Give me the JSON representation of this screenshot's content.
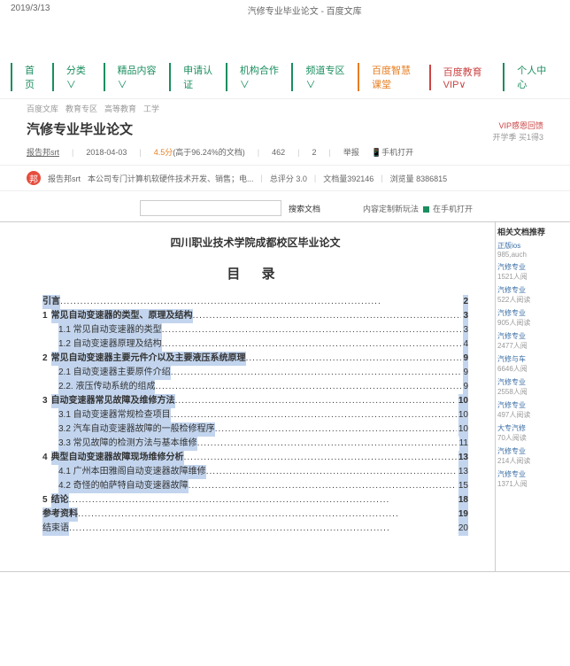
{
  "header": {
    "date": "2019/3/13",
    "pageTitle": "汽修专业毕业论文 - 百度文库"
  },
  "nav": [
    "首页",
    "分类 ∨",
    "精品内容 ∨",
    "申请认证",
    "机构合作 ∨",
    "频道专区 ∨",
    "百度智慧课堂",
    "百度教育VIP∨",
    "个人中心"
  ],
  "breadcrumb": [
    "百度文库",
    "教育专区",
    "高等教育",
    "工学"
  ],
  "title": "汽修专业毕业论文",
  "vip": {
    "line1": "VIP感恩回馈",
    "line2": "开学季 买1得3"
  },
  "meta": {
    "author": "报告邦srt",
    "date": "2018-04-03",
    "rating": "4.5分",
    "ratingSuffix": "(高于96.24%的文档)",
    "count1": "462",
    "count2": "2",
    "label": "举报",
    "extra": "手机打开"
  },
  "profile": {
    "avatarLetter": "邦",
    "name": "报告邦srt",
    "desc": "本公司专门计算机软硬件技术开发、销售；电...",
    "stats1": "总评分 3.0",
    "stats2": "文档量392146",
    "stats3": "浏览量 8386815"
  },
  "search": {
    "btn": "搜索文档",
    "opt1": "内容定制新玩法",
    "opt2": "在手机打开"
  },
  "doc": {
    "heading": "四川职业技术学院成都校区毕业论文",
    "tocTitle": "目 录"
  },
  "toc": [
    {
      "num": "",
      "txt": "引言",
      "pg": "2",
      "bold": true,
      "sub": false
    },
    {
      "num": "1",
      "txt": "常见自动变速器的类型、原理及结构",
      "pg": "3",
      "bold": true,
      "sub": false
    },
    {
      "num": "",
      "txt": "1.1 常见自动变速器的类型",
      "pg": "3",
      "bold": false,
      "sub": true
    },
    {
      "num": "",
      "txt": "1.2 自动变速器原理及结构",
      "pg": "4",
      "bold": false,
      "sub": true
    },
    {
      "num": "2",
      "txt": "常见自动变速器主要元件介以及主要液压系统原理",
      "pg": "9",
      "bold": true,
      "sub": false
    },
    {
      "num": "",
      "txt": "2.1 自动变速器主要原件介绍",
      "pg": "9",
      "bold": false,
      "sub": true
    },
    {
      "num": "",
      "txt": "2.2. 液压传动系统的组成",
      "pg": "9",
      "bold": false,
      "sub": true
    },
    {
      "num": "3",
      "txt": "自动变速器常见故障及维修方法",
      "pg": "10",
      "bold": true,
      "sub": false
    },
    {
      "num": "",
      "txt": "3.1 自动变速器常规检查项目",
      "pg": "10",
      "bold": false,
      "sub": true
    },
    {
      "num": "",
      "txt": "3.2 汽车自动变速器故障的一般检修程序",
      "pg": "10",
      "bold": false,
      "sub": true
    },
    {
      "num": "",
      "txt": "3.3 常见故障的检测方法与基本维修",
      "pg": "11",
      "bold": false,
      "sub": true
    },
    {
      "num": "4",
      "txt": "典型自动变速器故障现场维修分析",
      "pg": "13",
      "bold": true,
      "sub": false
    },
    {
      "num": "",
      "txt": "4.1 广州本田雅阁自动变速器故障维修",
      "pg": "13",
      "bold": false,
      "sub": true
    },
    {
      "num": "",
      "txt": "4.2 奇怪的帕萨特自动变速器故障",
      "pg": "15",
      "bold": false,
      "sub": true
    },
    {
      "num": "5",
      "txt": "结论",
      "pg": "18",
      "bold": true,
      "sub": false
    },
    {
      "num": "",
      "txt": "参考资料",
      "pg": "19",
      "bold": true,
      "sub": false
    },
    {
      "num": "",
      "txt": "结束语",
      "pg": "20",
      "bold": false,
      "sub": false
    }
  ],
  "sidebar": {
    "header": "相关文档推荐",
    "items": [
      {
        "t": "正版ios",
        "c": "985,auch"
      },
      {
        "t": "汽修专业",
        "c": "1521人阅"
      },
      {
        "t": "汽修专业",
        "c": "522人阅读"
      },
      {
        "t": "汽修专业",
        "c": "905人阅读"
      },
      {
        "t": "汽修专业",
        "c": "2477人阅"
      },
      {
        "t": "汽修与车",
        "c": "6646人阅"
      },
      {
        "t": "汽修专业",
        "c": "2558人阅"
      },
      {
        "t": "汽修专业",
        "c": "497人阅读"
      },
      {
        "t": "大专汽修",
        "c": "70人阅读"
      },
      {
        "t": "汽修专业",
        "c": "214人阅读"
      },
      {
        "t": "汽修专业",
        "c": "1371人阅"
      }
    ]
  }
}
